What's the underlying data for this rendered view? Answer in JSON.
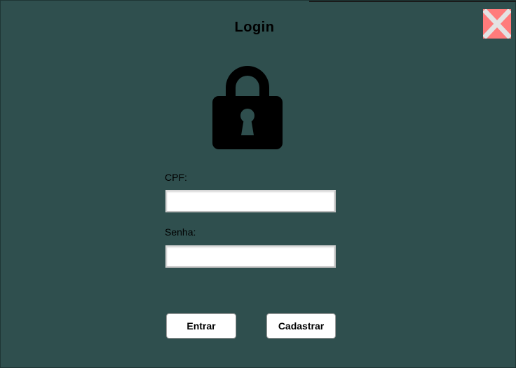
{
  "window": {
    "title": "Login"
  },
  "close_button": {
    "icon": "close-icon",
    "background": "#ff7b7b",
    "cross_color": "#e0e0e0"
  },
  "lock_icon": {
    "icon": "lock-icon",
    "color": "#000000"
  },
  "form": {
    "cpf_label": "CPF:",
    "cpf_value": "",
    "senha_label": "Senha:",
    "senha_value": ""
  },
  "buttons": {
    "entrar_label": "Entrar",
    "cadastrar_label": "Cadastrar"
  },
  "colors": {
    "background": "#2f4f4e"
  }
}
